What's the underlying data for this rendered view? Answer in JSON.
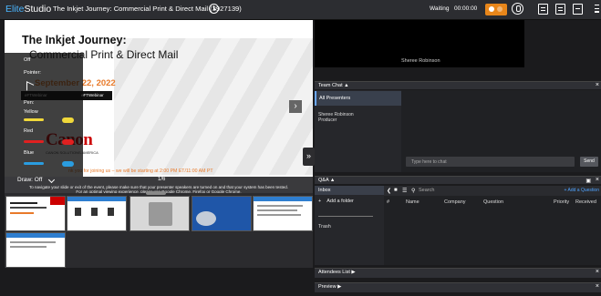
{
  "app": {
    "brand_prefix": "Elite",
    "brand_suffix": "Studio",
    "event_title": "The Inkjet Journey: Commercial Print & Direct Mail (3927139)",
    "status": "Waiting",
    "timer": "00:00:00"
  },
  "slide": {
    "title_line1": "The Inkjet Journey:",
    "title_line2": "Commercial Print & Direct Mail",
    "date": "September 22, 2022",
    "tag_left": "eFTWebinar",
    "tag_right": "eFTWebinar",
    "logo_text": "Canon",
    "logo_sub": "CANON SOLUTIONS AMERICA",
    "welcome": "nk you for joining us – we will be starting at 2:00 PM ET/11:00 AM PT",
    "next_glyph": "›"
  },
  "pen_panel": {
    "off": "Off",
    "pointer": "Pointer:",
    "pen": "Pen:",
    "colors": [
      {
        "name": "Yellow",
        "hex": "#f0d83a"
      },
      {
        "name": "Red",
        "hex": "#e02020"
      },
      {
        "name": "Blue",
        "hex": "#2a9de0"
      }
    ]
  },
  "draw_bar": {
    "label": "Draw:  Off",
    "page": "1/6"
  },
  "notice": {
    "line1": "To navigate your slide or exit of the event, please make sure that your presenter speakers are turned on and that your system has been tested.",
    "line2": "For an optimal viewing experience, please use Google Chrome, Firefox or Google Chrome."
  },
  "presenter": {
    "name": "Sheree Robinson"
  },
  "team_chat": {
    "header": "Team Chat",
    "all_presenters": "All Presenters",
    "member_name": "Sheree Robinson",
    "member_role": "Producer",
    "input_placeholder": "Type here to chat",
    "send": "Send"
  },
  "qa": {
    "header": "Q&A",
    "inbox": "Inbox",
    "add_folder": "Add a folder",
    "trash": "Trash",
    "search_placeholder": "Search",
    "add_question": "+ Add a Question",
    "columns": [
      "#",
      "Name",
      "Company",
      "Question",
      "Priority",
      "Received"
    ]
  },
  "panels": {
    "attendees": "Attendees List",
    "preview": "Preview"
  },
  "colors": {
    "accent_blue": "#4bb6ff",
    "record_orange": "#e8861a",
    "canon_red": "#cc0000",
    "slide_orange": "#e87a2a"
  }
}
